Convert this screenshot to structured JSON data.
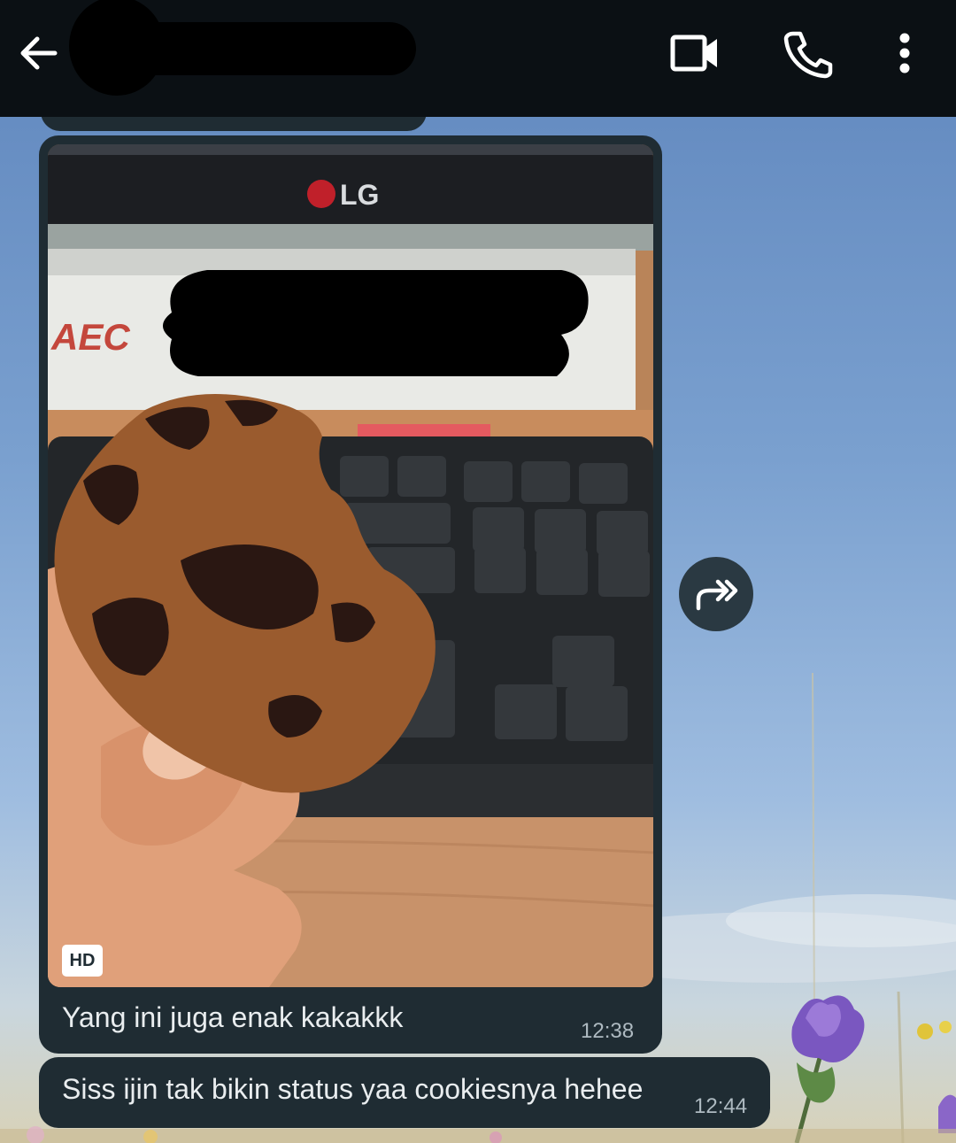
{
  "appbar": {
    "contact_name": "",
    "icons": {
      "back": "arrow-left-icon",
      "video": "video-camera-icon",
      "call": "phone-icon",
      "menu": "more-vertical-icon"
    }
  },
  "messages": [
    {
      "type": "image",
      "media_badge": "HD",
      "caption": "Yang ini juga enak kakakkk",
      "time": "12:38"
    },
    {
      "type": "text",
      "text": "Siss ijin tak bikin status yaa cookiesnya hehee",
      "time": "12:44"
    }
  ],
  "photo_text": {
    "monitor_brand": "LG",
    "sign_brand": "AEC"
  },
  "forward": {
    "icon": "forward-icon"
  },
  "colors": {
    "appbar_bg": "#0b1014",
    "bubble_bg": "#1f2c33",
    "bubble_text": "#e9edef",
    "timestamp": "#aebac1"
  }
}
